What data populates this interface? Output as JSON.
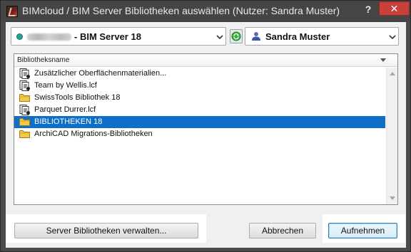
{
  "window": {
    "title": "BIMcloud / BIM Server Bibliotheken auswählen (Nutzer: Sandra Muster)",
    "help_label": "?",
    "close_label": "✕"
  },
  "server_select": {
    "value": "- BIM Server 18"
  },
  "user_select": {
    "value": "Sandra Muster"
  },
  "list": {
    "column_header": "Bibliotheksname",
    "items": [
      {
        "label": "Zusätzlicher Oberflächenmaterialien...",
        "icon": "library-file-icon",
        "selected": false
      },
      {
        "label": "Team by Wellis.lcf",
        "icon": "library-file-icon",
        "selected": false
      },
      {
        "label": "SwissTools Bibliothek 18",
        "icon": "folder-icon",
        "selected": false
      },
      {
        "label": "Parquet Durrer.lcf",
        "icon": "library-file-icon",
        "selected": false
      },
      {
        "label": "BIBLIOTHEKEN 18",
        "icon": "folder-icon",
        "selected": true
      },
      {
        "label": "ArchiCAD Migrations-Bibliotheken",
        "icon": "folder-icon",
        "selected": false
      }
    ]
  },
  "buttons": {
    "manage_label": "Server Bibliotheken verwalten...",
    "cancel_label": "Abbrechen",
    "add_label": "Aufnehmen"
  },
  "colors": {
    "selection": "#0f6fc6",
    "close_button": "#c7413a",
    "titlebar": "#454545"
  }
}
